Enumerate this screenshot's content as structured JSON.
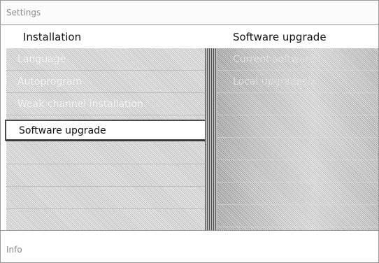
{
  "window": {
    "title": "Settings"
  },
  "header": {
    "left": "Installation",
    "right": "Software upgrade"
  },
  "menu": {
    "items": [
      {
        "label": "Language"
      },
      {
        "label": "Autoprogram"
      },
      {
        "label": "Weak channel installation"
      },
      {
        "label": "Software upgrade",
        "selected": true
      },
      {
        "label": ""
      },
      {
        "label": ""
      },
      {
        "label": ""
      },
      {
        "label": ""
      }
    ]
  },
  "submenu": {
    "items": [
      {
        "label": "Current software i"
      },
      {
        "label": "Local upgrades/a"
      },
      {
        "label": ""
      },
      {
        "label": ""
      },
      {
        "label": ""
      },
      {
        "label": ""
      },
      {
        "label": ""
      },
      {
        "label": ""
      }
    ]
  },
  "footer": {
    "info": "Info"
  }
}
